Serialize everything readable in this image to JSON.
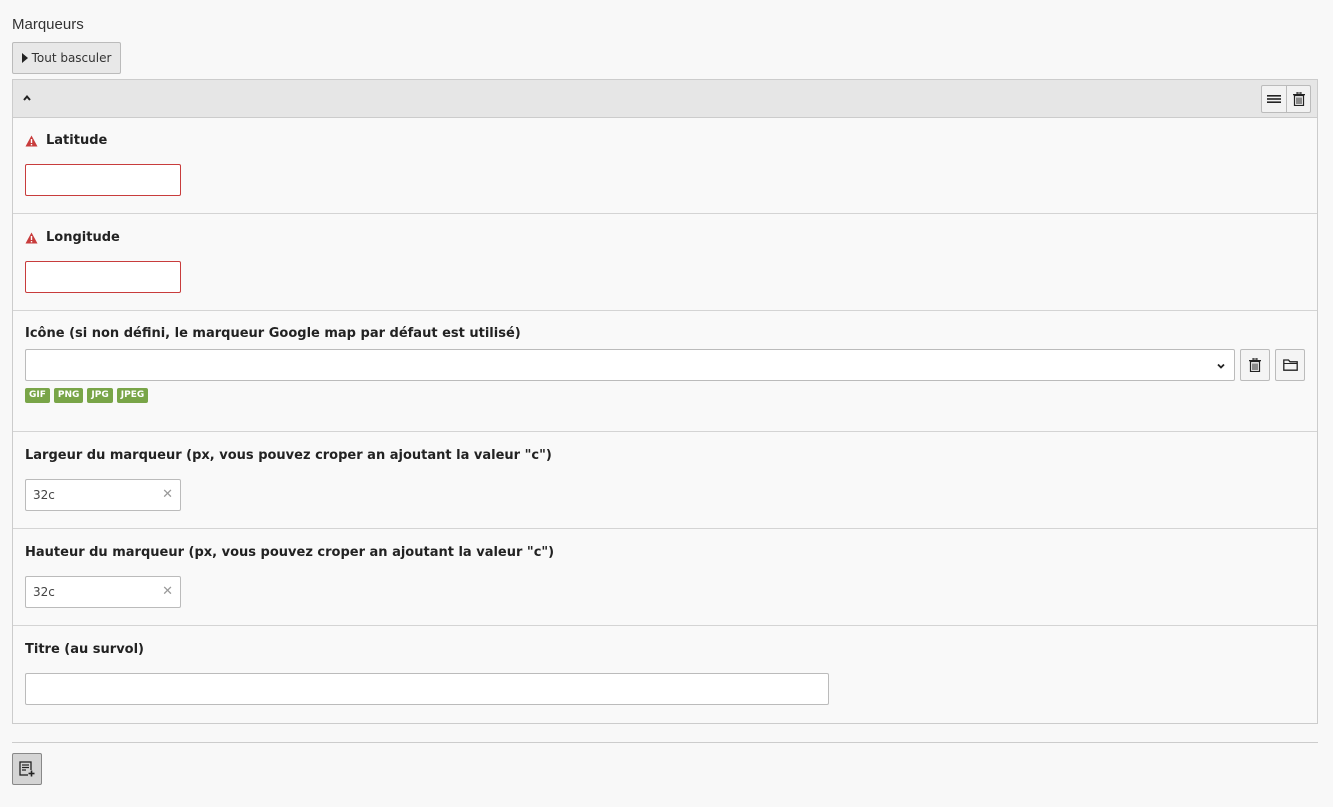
{
  "section": {
    "title": "Marqueurs",
    "toggle_all_label": "Tout basculer"
  },
  "item": {
    "header_icons": [
      "collapse-chevron-icon",
      "drag-handle-icon",
      "trash-icon"
    ],
    "fields": {
      "latitude": {
        "label": "Latitude",
        "value": "",
        "error": true
      },
      "longitude": {
        "label": "Longitude",
        "value": "",
        "error": true
      },
      "icon": {
        "label": "Icône (si non défini, le marqueur Google map par défaut est utilisé)",
        "value": "",
        "file_types": [
          "GIF",
          "PNG",
          "JPG",
          "JPEG"
        ]
      },
      "width": {
        "label": "Largeur du marqueur (px, vous pouvez croper an ajoutant la valeur \"c\")",
        "value": "32c"
      },
      "height": {
        "label": "Hauteur du marqueur (px, vous pouvez croper an ajoutant la valeur \"c\")",
        "value": "32c"
      },
      "title": {
        "label": "Titre (au survol)",
        "value": ""
      }
    }
  },
  "colors": {
    "error": "#c83c3c",
    "badge": "#79a548",
    "panel_header": "#e6e6e6"
  }
}
